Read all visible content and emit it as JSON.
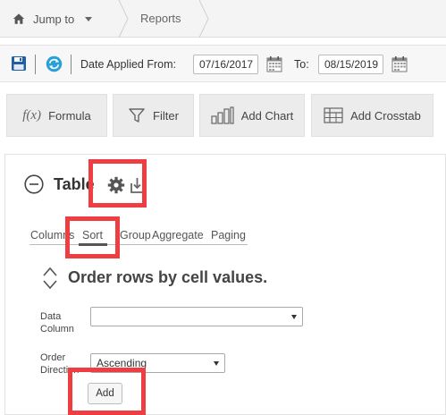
{
  "breadcrumb": {
    "jump_label": "Jump to",
    "current": "Reports"
  },
  "datebar": {
    "from_label": "Date Applied From:",
    "from_value": "07/16/2017",
    "to_label": "To:",
    "to_value": "08/15/2019"
  },
  "actions": {
    "formula_icon": "f(x)",
    "formula": "Formula",
    "filter": "Filter",
    "add_chart": "Add Chart",
    "add_crosstab": "Add Crosstab"
  },
  "panel": {
    "title": "Table",
    "tabs": [
      "Columns",
      "Sort",
      "Group",
      "Aggregate",
      "Paging"
    ],
    "active_tab": "Sort",
    "sort_heading": "Order rows by cell values.",
    "data_column_label": [
      "Data",
      "Column"
    ],
    "data_column_value": "",
    "order_direction_label": [
      "Order",
      "Direction"
    ],
    "order_direction_value": "Ascending",
    "add_label": "Add"
  },
  "colors": {
    "highlight": "#ee3e44",
    "save_icon": "#1f5fa8",
    "refresh_icon": "#2aa0d8"
  }
}
